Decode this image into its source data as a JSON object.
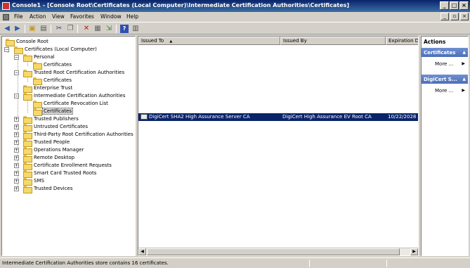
{
  "window": {
    "title": "Console1 - [Console Root\\Certificates (Local Computer)\\Intermediate Certification Authorities\\Certificates]"
  },
  "menu": {
    "items": [
      "File",
      "Action",
      "View",
      "Favorites",
      "Window",
      "Help"
    ]
  },
  "tree": {
    "root": "Console Root",
    "nodes": [
      "Certificates (Local Computer)",
      "Personal",
      "Certificates",
      "Trusted Root Certification Authorities",
      "Certificates",
      "Enterprise Trust",
      "Intermediate Certification Authorities",
      "Certificate Revocation List",
      "Certificates",
      "Trusted Publishers",
      "Untrusted Certificates",
      "Third-Party Root Certification Authorities",
      "Trusted People",
      "Operations Manager",
      "Remote Desktop",
      "Certificate Enrollment Requests",
      "Smart Card Trusted Roots",
      "SMS",
      "Trusted Devices"
    ]
  },
  "list": {
    "columns": [
      "Issued To",
      "Issued By",
      "Expiration D"
    ],
    "sort_indicator": "▲",
    "rows": [
      {
        "issued_to": "DigiCert SHA2 High Assurance Server CA",
        "issued_by": "DigiCert High Assurance EV Root CA",
        "expiration": "10/22/2028"
      }
    ]
  },
  "actions": {
    "title": "Actions",
    "sections": [
      {
        "label": "Certificates",
        "more": "More ..."
      },
      {
        "label": "DigiCert S...",
        "more": "More ..."
      }
    ]
  },
  "status": {
    "text": "Intermediate Certification Authorities store contains 16 certificates."
  }
}
